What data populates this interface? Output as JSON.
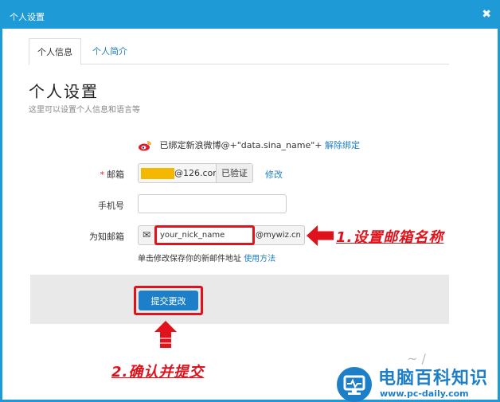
{
  "window": {
    "title": "个人设置",
    "close_symbol": "✖"
  },
  "tabs": [
    {
      "label": "个人信息",
      "active": true
    },
    {
      "label": "个人简介",
      "active": false
    }
  ],
  "page": {
    "heading": "个人设置",
    "subheading": "这里可以设置个人信息和语言等"
  },
  "weibo": {
    "text": "已绑定新浪微博@+\"data.sina_name\"+",
    "unbind_link": "解除绑定"
  },
  "form": {
    "email": {
      "required_mark": "*",
      "label": "邮箱",
      "domain": "@126.com",
      "verified": "已验证",
      "modify_link": "修改"
    },
    "phone": {
      "label": "手机号",
      "value": ""
    },
    "wiz_email": {
      "label": "为知邮箱",
      "mail_symbol": "✉",
      "value": "your_nick_name",
      "domain": "@mywiz.cn",
      "hint": "单击修改保存你的新邮件地址",
      "hint_link": "使用方法"
    },
    "submit_label": "提交更改"
  },
  "annotations": {
    "step1": "1.设置邮箱名称",
    "step2": "2.确认并提交"
  },
  "watermark": {
    "brand": "电脑百科知识",
    "url": "www.pc-daily.com"
  },
  "colors": {
    "titlebar": "#1e9ad6",
    "link": "#1e7fc1",
    "highlight": "#e0121b",
    "mask": "#f5b800",
    "button": "#1e7fc9"
  }
}
